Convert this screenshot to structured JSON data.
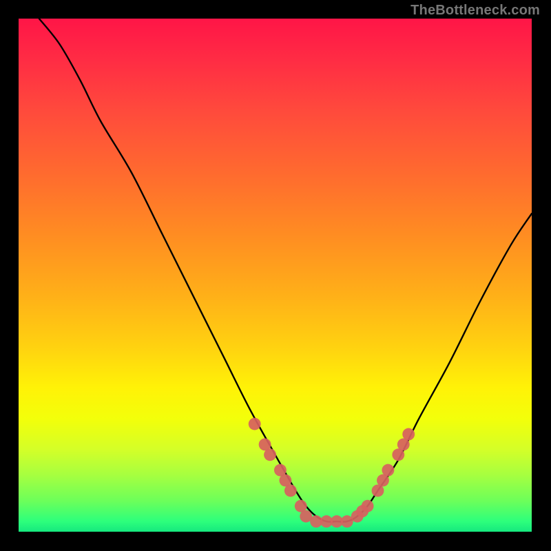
{
  "watermark": "TheBottleneck.com",
  "chart_data": {
    "type": "line",
    "title": "",
    "xlabel": "",
    "ylabel": "",
    "xlim": [
      0,
      100
    ],
    "ylim": [
      0,
      100
    ],
    "grid": false,
    "legend": false,
    "series": [
      {
        "name": "curve",
        "color": "#000000",
        "x": [
          4,
          8,
          12,
          16,
          22,
          28,
          34,
          40,
          45,
          50,
          54,
          56,
          58,
          60,
          62,
          64,
          66,
          68,
          70,
          74,
          78,
          84,
          90,
          96,
          100
        ],
        "values": [
          100,
          95,
          88,
          80,
          70,
          58,
          46,
          34,
          24,
          15,
          8,
          5,
          3,
          2,
          2,
          2,
          3,
          5,
          8,
          14,
          22,
          33,
          45,
          56,
          62
        ]
      }
    ],
    "highlight_points": {
      "name": "markers",
      "color": "#d7615f",
      "radius_fraction": 0.012,
      "left_cluster": {
        "x": [
          46,
          48,
          49,
          51,
          52,
          53,
          55
        ],
        "values": [
          21,
          17,
          15,
          12,
          10,
          8,
          5
        ]
      },
      "floor_cluster": {
        "x": [
          56,
          58,
          60,
          62,
          64,
          66,
          67,
          68
        ],
        "values": [
          3,
          2,
          2,
          2,
          2,
          3,
          4,
          5
        ]
      },
      "right_cluster": {
        "x": [
          70,
          71,
          72,
          74,
          75,
          76
        ],
        "values": [
          8,
          10,
          12,
          15,
          17,
          19
        ]
      }
    }
  }
}
